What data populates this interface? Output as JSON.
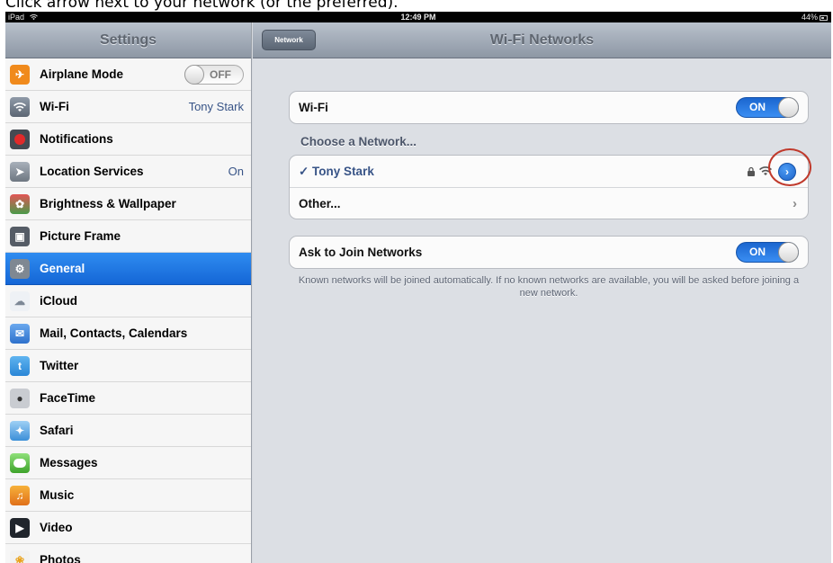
{
  "caption": "Click arrow next to your network (or the preferred).",
  "status_bar": {
    "device": "iPad",
    "time": "12:49 PM",
    "battery": "44%"
  },
  "sidebar": {
    "title": "Settings",
    "items": [
      {
        "label": "Airplane Mode",
        "icon": "airplane-icon",
        "toggle": "OFF"
      },
      {
        "label": "Wi-Fi",
        "icon": "wifi-icon",
        "value": "Tony Stark"
      },
      {
        "label": "Notifications",
        "icon": "notifications-icon"
      },
      {
        "label": "Location Services",
        "icon": "location-icon",
        "value": "On"
      },
      {
        "label": "Brightness & Wallpaper",
        "icon": "brightness-icon"
      },
      {
        "label": "Picture Frame",
        "icon": "picture-frame-icon"
      },
      {
        "label": "General",
        "icon": "gear-icon",
        "selected": true
      },
      {
        "label": "iCloud",
        "icon": "cloud-icon"
      },
      {
        "label": "Mail, Contacts, Calendars",
        "icon": "mail-icon"
      },
      {
        "label": "Twitter",
        "icon": "twitter-icon"
      },
      {
        "label": "FaceTime",
        "icon": "camera-icon"
      },
      {
        "label": "Safari",
        "icon": "compass-icon"
      },
      {
        "label": "Messages",
        "icon": "message-icon"
      },
      {
        "label": "Music",
        "icon": "music-icon"
      },
      {
        "label": "Video",
        "icon": "video-icon"
      },
      {
        "label": "Photos",
        "icon": "photos-icon"
      }
    ]
  },
  "detail": {
    "back_label": "Network",
    "title": "Wi-Fi Networks",
    "wifi_label": "Wi-Fi",
    "wifi_toggle": "ON",
    "choose_header": "Choose a Network...",
    "network_name": "✓ Tony Stark",
    "other_label": "Other...",
    "ask_label": "Ask to Join Networks",
    "ask_toggle": "ON",
    "footnote": "Known networks will be joined automatically. If no known networks are available, you will be asked before joining a new network."
  },
  "colors": {
    "accent": "#1b66cf",
    "selected_row": "#1466d6",
    "highlight_ring": "#c0392b"
  }
}
